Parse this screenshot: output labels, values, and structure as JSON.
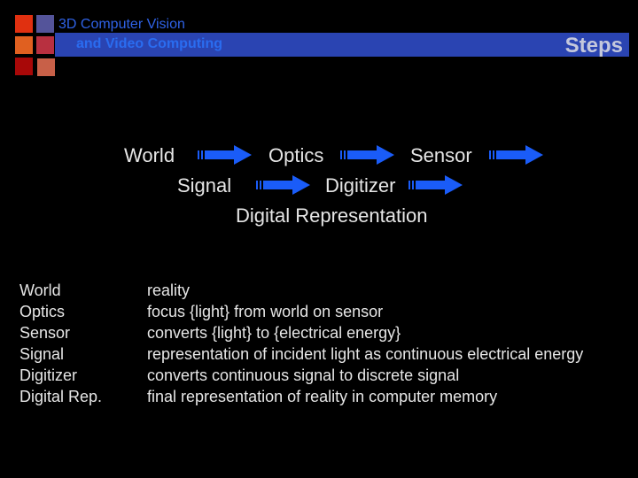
{
  "header": {
    "course_line1": "3D Computer Vision",
    "course_line2": "and Video Computing",
    "slide_title": "Steps",
    "logo_colors": [
      "#e03010",
      "#54549a",
      "#e06020",
      "#b83040",
      "#a80808",
      "#c86048"
    ]
  },
  "flow": {
    "world": "World",
    "optics": "Optics",
    "sensor": "Sensor",
    "signal": "Signal",
    "digitizer": "Digitizer",
    "digital_representation": "Digital Representation",
    "arrow_color": "#1a5cf8"
  },
  "definitions": [
    {
      "term": "World",
      "description": "reality"
    },
    {
      "term": "Optics",
      "description": "focus {light} from world on sensor"
    },
    {
      "term": "Sensor",
      "description": "converts {light} to {electrical energy}"
    },
    {
      "term": "Signal",
      "description": "representation of incident light as continuous electrical energy"
    },
    {
      "term": "Digitizer",
      "description": "converts continuous signal to discrete signal"
    },
    {
      "term": "Digital Rep.",
      "description": "final representation of reality in computer memory"
    }
  ]
}
